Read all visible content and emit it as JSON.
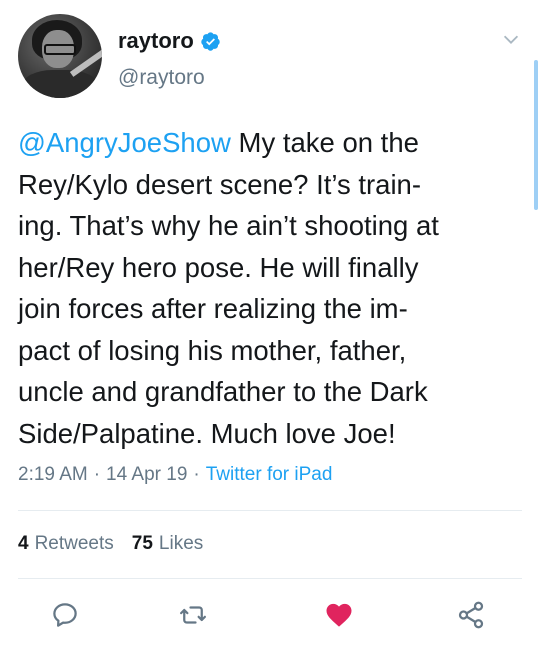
{
  "user": {
    "display_name": "raytoro",
    "handle": "@raytoro",
    "verified": true
  },
  "tweet": {
    "mention": "@AngryJoeShow",
    "lines": [
      " My take on the",
      "Rey/Kylo desert scene? It’s train-",
      "ing. That’s why he ain’t shooting at",
      "her/Rey hero pose. He will finally",
      "join forces after realizing the im-",
      "pact of losing his mother, father,",
      "uncle and grandfather to the Dark",
      "Side/Palpatine. Much love Joe!"
    ]
  },
  "meta": {
    "time": "2:19 AM",
    "separator": "·",
    "date": "14 Apr 19",
    "source": "Twitter for iPad"
  },
  "stats": {
    "retweets_count": "4",
    "retweets_label": "Retweets",
    "likes_count": "75",
    "likes_label": "Likes"
  },
  "icons": {
    "verified": "verified-badge-icon",
    "more": "chevron-down-icon",
    "reply": "reply-icon",
    "retweet": "retweet-icon",
    "like": "heart-icon",
    "share": "share-icon"
  },
  "colors": {
    "accent": "#1da1f2",
    "like": "#e0245e",
    "secondary_text": "#657786",
    "text": "#14171a"
  }
}
